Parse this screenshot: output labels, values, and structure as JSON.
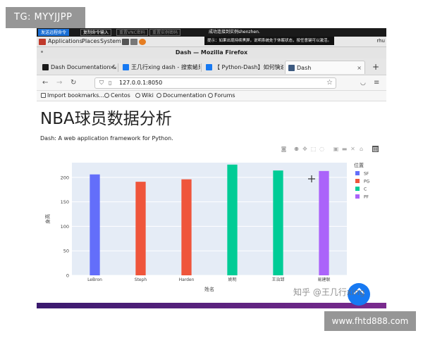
{
  "watermarks": {
    "top": "TG: MYYJJPP",
    "bottom": "www.fhtd888.com",
    "zhihu": "知乎 @王几行xing"
  },
  "vnc": {
    "buttons": [
      "发送远程命令",
      "复制命令输入",
      "重置VNC密码",
      "重置实例密码"
    ],
    "status": "成功连接到实例shenzhen.",
    "hint": "提示：如果出现持续黑屏，说明系统处于休眠状态，按任意键可以激活。"
  },
  "gnome": {
    "applications": "Applications",
    "places": "Places",
    "system": "System",
    "user": "rhu"
  },
  "window": {
    "title": "Dash — Mozilla Firefox"
  },
  "tabs": [
    {
      "label": "Dash Documentation & U",
      "favicon": "dash-doc-icon",
      "color": "#1a1a1a"
    },
    {
      "label": "王几行xing dash - 搜索结果",
      "favicon": "zhihu-icon",
      "color": "#1779f2"
    },
    {
      "label": "【 Python-Dash】如何快速",
      "favicon": "zhihu-icon",
      "color": "#1779f2"
    },
    {
      "label": "Dash",
      "favicon": "dash-icon",
      "color": "#3d5a80"
    }
  ],
  "nav": {
    "url": "127.0.0.1:8050"
  },
  "bookmarks": [
    "Import bookmarks...",
    "Centos",
    "Wiki",
    "Documentation",
    "Forums"
  ],
  "page": {
    "title": "NBA球员数据分析",
    "subtitle": "Dash: A web application framework for Python."
  },
  "chart_data": {
    "type": "bar",
    "categories": [
      "LeBron",
      "Steph",
      "Harden",
      "姚明",
      "王治郅",
      "易建联"
    ],
    "series": [
      {
        "name": "SF",
        "color": "#636efa",
        "x": [
          "LeBron"
        ],
        "values": [
          206
        ]
      },
      {
        "name": "PG",
        "color": "#ef553b",
        "x": [
          "Steph",
          "Harden"
        ],
        "values": [
          191,
          196
        ]
      },
      {
        "name": "C",
        "color": "#00cc96",
        "x": [
          "姚明",
          "王治郅"
        ],
        "values": [
          226,
          214
        ]
      },
      {
        "name": "PF",
        "color": "#ab63fa",
        "x": [
          "易建联"
        ],
        "values": [
          213
        ]
      }
    ],
    "title": "",
    "xlabel": "姓名",
    "ylabel": "身高",
    "legend_title": "位置",
    "legend_position": "right",
    "yticks": [
      0,
      50,
      100,
      150,
      200
    ],
    "ylim": [
      0,
      230
    ],
    "grid": true
  }
}
